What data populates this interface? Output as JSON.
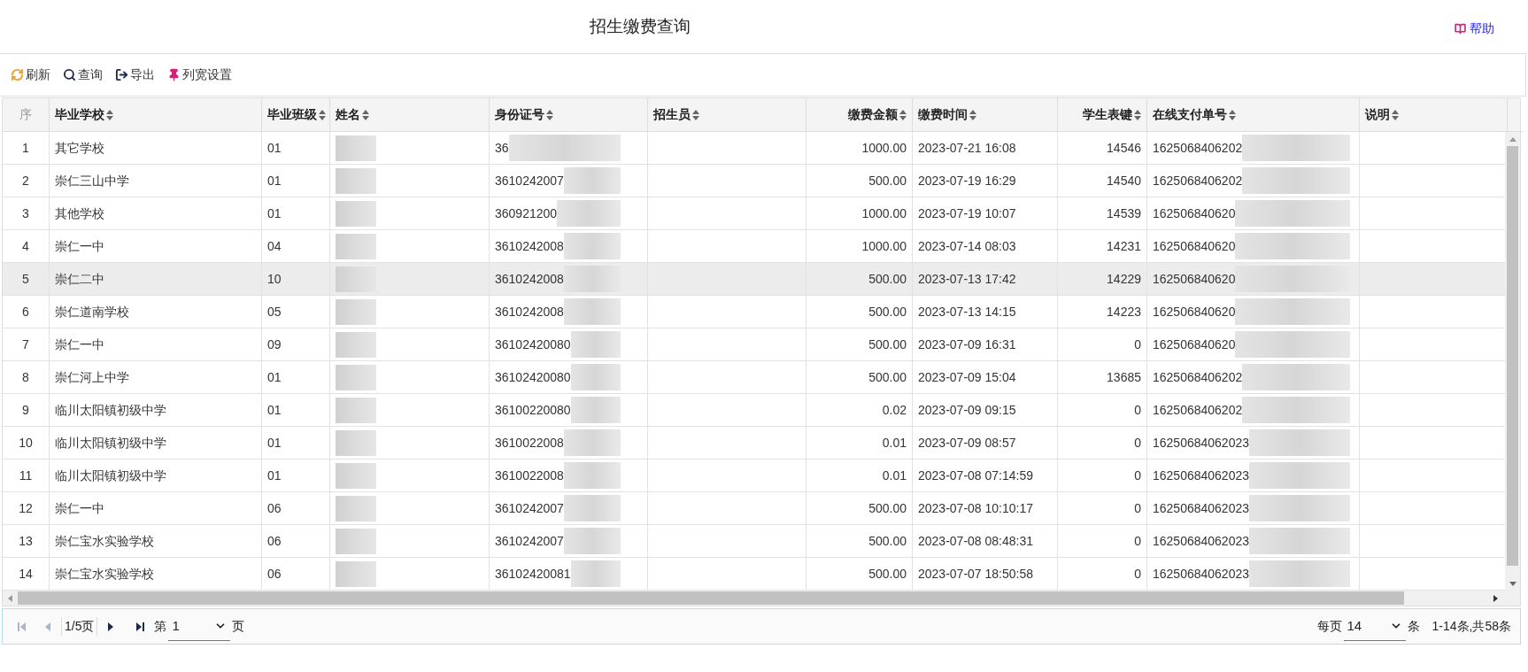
{
  "title": "招生缴费查询",
  "help": {
    "label": "帮助"
  },
  "toolbar": [
    {
      "kind": "refresh",
      "label": "刷新"
    },
    {
      "kind": "search",
      "label": "查询"
    },
    {
      "kind": "export",
      "label": "导出"
    },
    {
      "kind": "pin",
      "label": "列宽设置"
    }
  ],
  "columns": [
    {
      "label": "序",
      "sortable": false,
      "kind": "index",
      "masked": false
    },
    {
      "label": "毕业学校",
      "sortable": true,
      "kind": "text",
      "masked": false
    },
    {
      "label": "毕业班级",
      "sortable": true,
      "kind": "text",
      "masked": false
    },
    {
      "label": "姓名",
      "sortable": true,
      "kind": "text",
      "masked": true
    },
    {
      "label": "身份证号",
      "sortable": true,
      "kind": "text",
      "masked": true
    },
    {
      "label": "招生员",
      "sortable": true,
      "kind": "text",
      "masked": false
    },
    {
      "label": "缴费金额",
      "sortable": true,
      "kind": "number",
      "masked": false
    },
    {
      "label": "缴费时间",
      "sortable": true,
      "kind": "text",
      "masked": false
    },
    {
      "label": "学生表键",
      "sortable": true,
      "kind": "number",
      "masked": false
    },
    {
      "label": "在线支付单号",
      "sortable": true,
      "kind": "text",
      "masked": true
    },
    {
      "label": "说明",
      "sortable": true,
      "kind": "text",
      "masked": false
    }
  ],
  "rows": [
    {
      "selected": false,
      "cells": [
        "1",
        "其它学校",
        "01",
        null,
        "36",
        null,
        "1000.00",
        "2023-07-21 16:08",
        "14546",
        "1625068406202",
        null
      ]
    },
    {
      "selected": false,
      "cells": [
        "2",
        "崇仁三山中学",
        "01",
        null,
        "3610242007",
        null,
        "500.00",
        "2023-07-19 16:29",
        "14540",
        "1625068406202",
        null
      ]
    },
    {
      "selected": false,
      "cells": [
        "3",
        "其他学校",
        "01",
        null,
        "360921200",
        null,
        "1000.00",
        "2023-07-19 10:07",
        "14539",
        "162506840620",
        null
      ]
    },
    {
      "selected": false,
      "cells": [
        "4",
        "崇仁一中",
        "04",
        null,
        "3610242008",
        null,
        "1000.00",
        "2023-07-14 08:03",
        "14231",
        "162506840620",
        null
      ]
    },
    {
      "selected": true,
      "cells": [
        "5",
        "崇仁二中",
        "10",
        null,
        "3610242008",
        null,
        "500.00",
        "2023-07-13 17:42",
        "14229",
        "162506840620",
        null
      ]
    },
    {
      "selected": false,
      "cells": [
        "6",
        "崇仁道南学校",
        "05",
        null,
        "3610242008",
        null,
        "500.00",
        "2023-07-13 14:15",
        "14223",
        "162506840620",
        null
      ]
    },
    {
      "selected": false,
      "cells": [
        "7",
        "崇仁一中",
        "09",
        null,
        "36102420080",
        null,
        "500.00",
        "2023-07-09 16:31",
        "0",
        "162506840620",
        null
      ]
    },
    {
      "selected": false,
      "cells": [
        "8",
        "崇仁河上中学",
        "01",
        null,
        "36102420080",
        null,
        "500.00",
        "2023-07-09 15:04",
        "13685",
        "1625068406202",
        null
      ]
    },
    {
      "selected": false,
      "cells": [
        "9",
        "临川太阳镇初级中学",
        "01",
        null,
        "36100220080",
        null,
        "0.02",
        "2023-07-09 09:15",
        "0",
        "1625068406202",
        null
      ]
    },
    {
      "selected": false,
      "cells": [
        "10",
        "临川太阳镇初级中学",
        "01",
        null,
        "3610022008",
        null,
        "0.01",
        "2023-07-09 08:57",
        "0",
        "16250684062023",
        null
      ]
    },
    {
      "selected": false,
      "cells": [
        "11",
        "临川太阳镇初级中学",
        "01",
        null,
        "3610022008",
        null,
        "0.01",
        "2023-07-08 07:14:59",
        "0",
        "16250684062023",
        null
      ]
    },
    {
      "selected": false,
      "cells": [
        "12",
        "崇仁一中",
        "06",
        null,
        "3610242007",
        null,
        "500.00",
        "2023-07-08 10:10:17",
        "0",
        "16250684062023",
        null
      ]
    },
    {
      "selected": false,
      "cells": [
        "13",
        "崇仁宝水实验学校",
        "06",
        null,
        "3610242007",
        null,
        "500.00",
        "2023-07-08 08:48:31",
        "0",
        "16250684062023",
        null
      ]
    },
    {
      "selected": false,
      "cells": [
        "14",
        "崇仁宝水实验学校",
        "06",
        null,
        "36102420081",
        null,
        "500.00",
        "2023-07-07 18:50:58",
        "0",
        "16250684062023",
        null
      ]
    }
  ],
  "pager": {
    "page_info": "1/5页",
    "page_prefix": "第",
    "page": "1",
    "page_suffix": "页",
    "per_page_prefix": "每页",
    "per_page": "14",
    "per_page_suffix": "条",
    "summary": "1-14条,共58条"
  }
}
